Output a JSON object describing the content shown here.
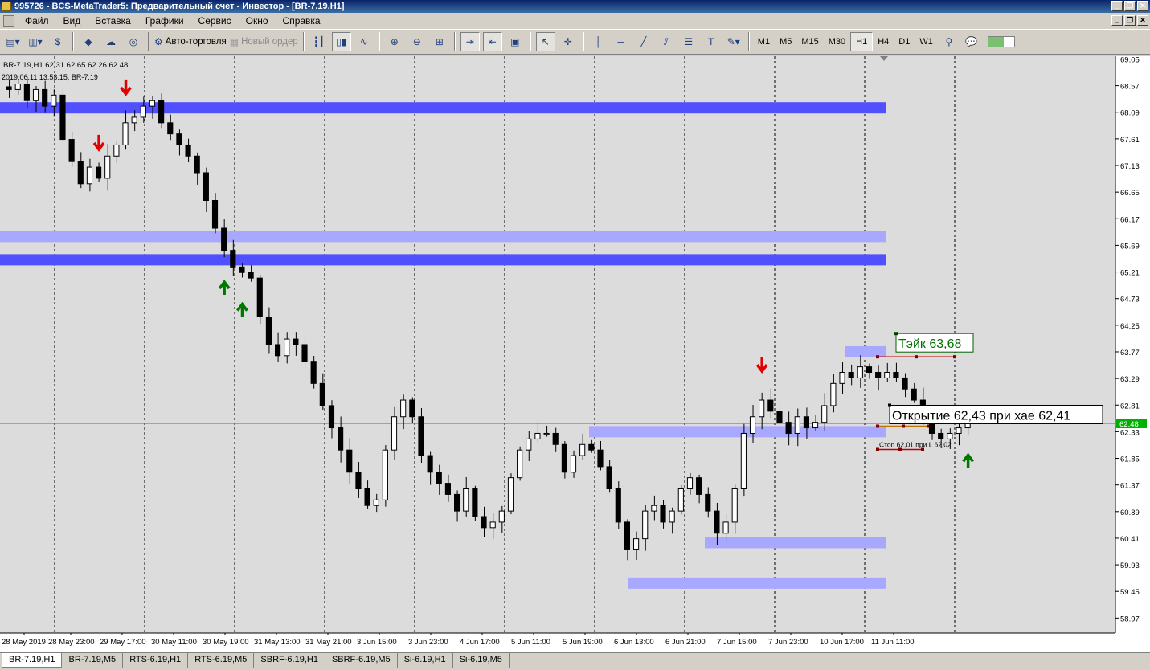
{
  "window": {
    "title": "995726 - BCS-MetaTrader5: Предварительный счет - Инвестор - [BR-7.19,H1]"
  },
  "menu": {
    "items": [
      "Файл",
      "Вид",
      "Вставка",
      "Графики",
      "Сервис",
      "Окно",
      "Справка"
    ]
  },
  "toolbar": {
    "autotrading_label": "Авто-торговля",
    "new_order_label": "Новый ордер",
    "timeframes": [
      "M1",
      "M5",
      "M15",
      "M30",
      "H1",
      "H4",
      "D1",
      "W1"
    ],
    "active_timeframe": "H1"
  },
  "chart": {
    "info_line1": "BR-7.19,H1  62.31 62.65 62.26 62.48",
    "info_line2": "2019.06.11 13:53:15; BR-7.19",
    "current_price": "62.48",
    "take_label": "Тэйк 63,68",
    "open_label": "Открытие 62,43 при хае 62,41",
    "stop_label": "Стоп 62,01 при L 62,02",
    "colors": {
      "background": "#dcdcdc",
      "bull": "#ffffff",
      "bear": "#000000",
      "zone_dark": "#5050ff",
      "zone_light": "#a8a8ff",
      "price_line": "#00b000",
      "arrow_down": "#e00000",
      "arrow_up": "#007800"
    }
  },
  "chart_data": {
    "type": "candlestick",
    "symbol": "BR-7.19",
    "timeframe": "H1",
    "y_ticks": [
      "69.05",
      "68.57",
      "68.09",
      "67.61",
      "67.13",
      "66.65",
      "66.17",
      "65.69",
      "65.21",
      "64.73",
      "64.25",
      "63.77",
      "63.29",
      "62.81",
      "62.33",
      "61.85",
      "61.37",
      "60.89",
      "60.41",
      "59.93",
      "59.45",
      "58.97"
    ],
    "x_ticks": [
      "28 May 2019",
      "28 May 23:00",
      "29 May 17:00",
      "30 May 11:00",
      "30 May 19:00",
      "31 May 13:00",
      "31 May 21:00",
      "3 Jun 15:00",
      "3 Jun 23:00",
      "4 Jun 17:00",
      "5 Jun 11:00",
      "5 Jun 19:00",
      "6 Jun 13:00",
      "6 Jun 21:00",
      "7 Jun 15:00",
      "7 Jun 23:00",
      "10 Jun 17:00",
      "11 Jun 11:00"
    ],
    "ylim": [
      58.7,
      69.1
    ],
    "close_path": [
      68.5,
      68.6,
      68.3,
      68.5,
      68.2,
      68.4,
      67.6,
      67.2,
      66.8,
      67.1,
      66.9,
      67.3,
      67.5,
      67.9,
      68.0,
      68.2,
      68.3,
      67.9,
      67.7,
      67.5,
      67.3,
      67.0,
      66.5,
      66.0,
      65.6,
      65.3,
      65.2,
      65.1,
      64.4,
      63.9,
      63.7,
      64.0,
      63.9,
      63.6,
      63.2,
      62.8,
      62.4,
      62.0,
      61.6,
      61.3,
      61.0,
      61.1,
      62.0,
      62.6,
      62.9,
      62.6,
      61.9,
      61.6,
      61.4,
      61.2,
      60.9,
      61.3,
      60.8,
      60.6,
      60.7,
      60.9,
      61.5,
      62.0,
      62.2,
      62.3,
      62.3,
      62.1,
      61.6,
      61.9,
      62.1,
      62.0,
      61.7,
      61.3,
      60.7,
      60.2,
      60.4,
      60.9,
      61.0,
      60.7,
      60.9,
      61.3,
      61.5,
      61.2,
      60.9,
      60.5,
      60.7,
      61.3,
      62.3,
      62.6,
      62.9,
      62.7,
      62.5,
      62.3,
      62.6,
      62.4,
      62.5,
      62.8,
      63.2,
      63.4,
      63.3,
      63.5,
      63.4,
      63.3,
      63.4,
      63.3,
      63.1,
      62.9,
      62.6,
      62.3,
      62.2,
      62.3,
      62.4,
      62.48
    ],
    "horizontal_zones": [
      {
        "price": 68.17,
        "style": "dark"
      },
      {
        "price": 65.85,
        "style": "light"
      },
      {
        "price": 65.43,
        "style": "dark"
      },
      {
        "price": 63.77,
        "style": "light"
      },
      {
        "price": 62.33,
        "style": "light"
      },
      {
        "price": 60.33,
        "style": "light"
      },
      {
        "price": 59.6,
        "style": "light"
      }
    ],
    "levels": {
      "current": 62.48,
      "take": 63.68,
      "open": 62.43,
      "stop": 62.01
    },
    "signals": [
      {
        "type": "sell",
        "bar": 10
      },
      {
        "type": "sell",
        "bar": 13
      },
      {
        "type": "buy",
        "bar": 24
      },
      {
        "type": "buy",
        "bar": 26
      },
      {
        "type": "sell",
        "bar": 84
      },
      {
        "type": "buy",
        "bar": 107
      }
    ]
  },
  "tabs": [
    "BR-7.19,H1",
    "BR-7.19,M5",
    "RTS-6.19,H1",
    "RTS-6.19,M5",
    "SBRF-6.19,H1",
    "SBRF-6.19,M5",
    "Si-6.19,H1",
    "Si-6.19,M5"
  ],
  "active_tab": "BR-7.19,H1"
}
